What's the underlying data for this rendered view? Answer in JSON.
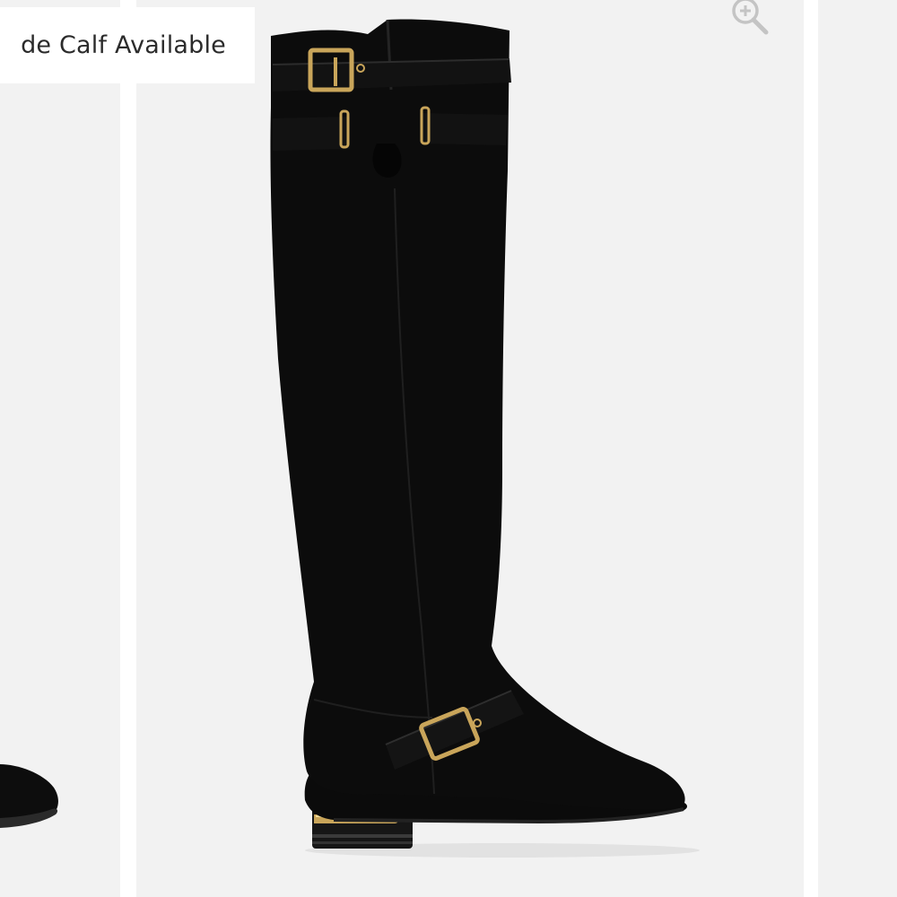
{
  "product_gallery": {
    "badge": {
      "label": "de Calf Available"
    },
    "zoom_icon": "zoom-in-icon",
    "main_image": "black-suede-over-the-knee-boot",
    "colors": {
      "panel_background": "#f2f2f2",
      "gutter": "#ffffff",
      "badge_text": "#2b2b2b",
      "zoom_icon": "#c4c4c4",
      "boot": "#0c0c0c",
      "hardware": "#c9a55a"
    }
  }
}
